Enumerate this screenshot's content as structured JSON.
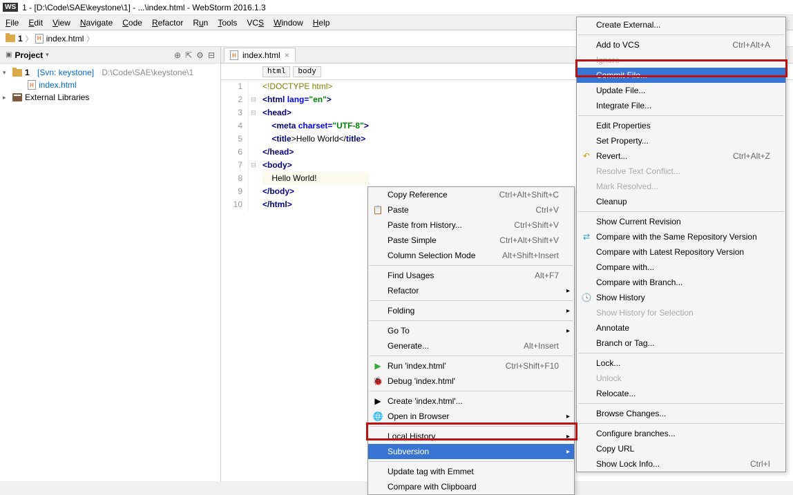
{
  "title": "1 - [D:\\Code\\SAE\\keystone\\1] - ...\\index.html - WebStorm 2016.1.3",
  "menubar": [
    "File",
    "Edit",
    "View",
    "Navigate",
    "Code",
    "Refactor",
    "Run",
    "Tools",
    "VCS",
    "Window",
    "Help"
  ],
  "navbar": {
    "folder": "1",
    "file": "index.html"
  },
  "project": {
    "title": "Project",
    "root": "1",
    "svn": "[Svn: keystone]",
    "rootpath": "D:\\Code\\SAE\\keystone\\1",
    "file": "index.html",
    "libs": "External Libraries"
  },
  "editor": {
    "tab": "index.html",
    "crumb1": "html",
    "crumb2": "body",
    "lines": {
      "l1": "<!DOCTYPE html>",
      "l2a": "<",
      "l2b": "html ",
      "l2c": "lang=",
      "l2d": "\"en\"",
      "l2e": ">",
      "l3a": "<",
      "l3b": "head",
      "l3c": ">",
      "l4a": "<",
      "l4b": "meta ",
      "l4c": "charset=",
      "l4d": "\"UTF-8\"",
      "l4e": ">",
      "l5a": "<",
      "l5b": "title",
      "l5c": ">Hello World</",
      "l5d": "title",
      "l5e": ">",
      "l6a": "</",
      "l6b": "head",
      "l6c": ">",
      "l7a": "<",
      "l7b": "body",
      "l7c": ">",
      "l8": "    Hello World!",
      "l9a": "</",
      "l9b": "body",
      "l9c": ">",
      "l10a": "</",
      "l10b": "html",
      "l10c": ">"
    }
  },
  "context_menu": [
    {
      "label": "Copy Reference",
      "shortcut": "Ctrl+Alt+Shift+C"
    },
    {
      "label": "Paste",
      "shortcut": "Ctrl+V",
      "icon": "📋"
    },
    {
      "label": "Paste from History...",
      "shortcut": "Ctrl+Shift+V"
    },
    {
      "label": "Paste Simple",
      "shortcut": "Ctrl+Alt+Shift+V"
    },
    {
      "label": "Column Selection Mode",
      "shortcut": "Alt+Shift+Insert"
    },
    {
      "sep": true
    },
    {
      "label": "Find Usages",
      "shortcut": "Alt+F7"
    },
    {
      "label": "Refactor",
      "sub": true
    },
    {
      "sep": true
    },
    {
      "label": "Folding",
      "sub": true
    },
    {
      "sep": true
    },
    {
      "label": "Go To",
      "sub": true
    },
    {
      "label": "Generate...",
      "shortcut": "Alt+Insert"
    },
    {
      "sep": true
    },
    {
      "label": "Run 'index.html'",
      "shortcut": "Ctrl+Shift+F10",
      "icon": "▶",
      "iconcolor": "#3a3"
    },
    {
      "label": "Debug 'index.html'",
      "icon": "🐞"
    },
    {
      "sep": true
    },
    {
      "label": "Create 'index.html'...",
      "icon": "▶"
    },
    {
      "label": "Open in Browser",
      "sub": true,
      "icon": "🌐"
    },
    {
      "sep": true
    },
    {
      "label": "Local History",
      "sub": true
    },
    {
      "label": "Subversion",
      "sub": true,
      "selected": true
    },
    {
      "sep": true
    },
    {
      "label": "Update tag with Emmet"
    },
    {
      "label": "Compare with Clipboard"
    }
  ],
  "svn_menu": [
    {
      "label": "Create External..."
    },
    {
      "sep": true
    },
    {
      "label": "Add to VCS",
      "shortcut": "Ctrl+Alt+A"
    },
    {
      "label": "Ignore",
      "disabled": true
    },
    {
      "label": "Commit File...",
      "selected": true
    },
    {
      "label": "Update File..."
    },
    {
      "label": "Integrate File..."
    },
    {
      "sep": true
    },
    {
      "label": "Edit Properties"
    },
    {
      "label": "Set Property..."
    },
    {
      "label": "Revert...",
      "shortcut": "Ctrl+Alt+Z",
      "icon": "↶",
      "iconcolor": "#c90"
    },
    {
      "label": "Resolve Text Conflict...",
      "disabled": true
    },
    {
      "label": "Mark Resolved...",
      "disabled": true
    },
    {
      "label": "Cleanup"
    },
    {
      "sep": true
    },
    {
      "label": "Show Current Revision"
    },
    {
      "label": "Compare with the Same Repository Version",
      "icon": "⇄",
      "iconcolor": "#39c"
    },
    {
      "label": "Compare with Latest Repository Version"
    },
    {
      "label": "Compare with..."
    },
    {
      "label": "Compare with Branch..."
    },
    {
      "label": "Show History",
      "icon": "🕓"
    },
    {
      "label": "Show History for Selection",
      "disabled": true
    },
    {
      "label": "Annotate"
    },
    {
      "label": "Branch or Tag..."
    },
    {
      "sep": true
    },
    {
      "label": "Lock..."
    },
    {
      "label": "Unlock",
      "disabled": true
    },
    {
      "label": "Relocate..."
    },
    {
      "sep": true
    },
    {
      "label": "Browse Changes..."
    },
    {
      "sep": true
    },
    {
      "label": "Configure branches..."
    },
    {
      "label": "Copy URL"
    },
    {
      "label": "Show Lock Info...",
      "shortcut": "Ctrl+I"
    }
  ]
}
